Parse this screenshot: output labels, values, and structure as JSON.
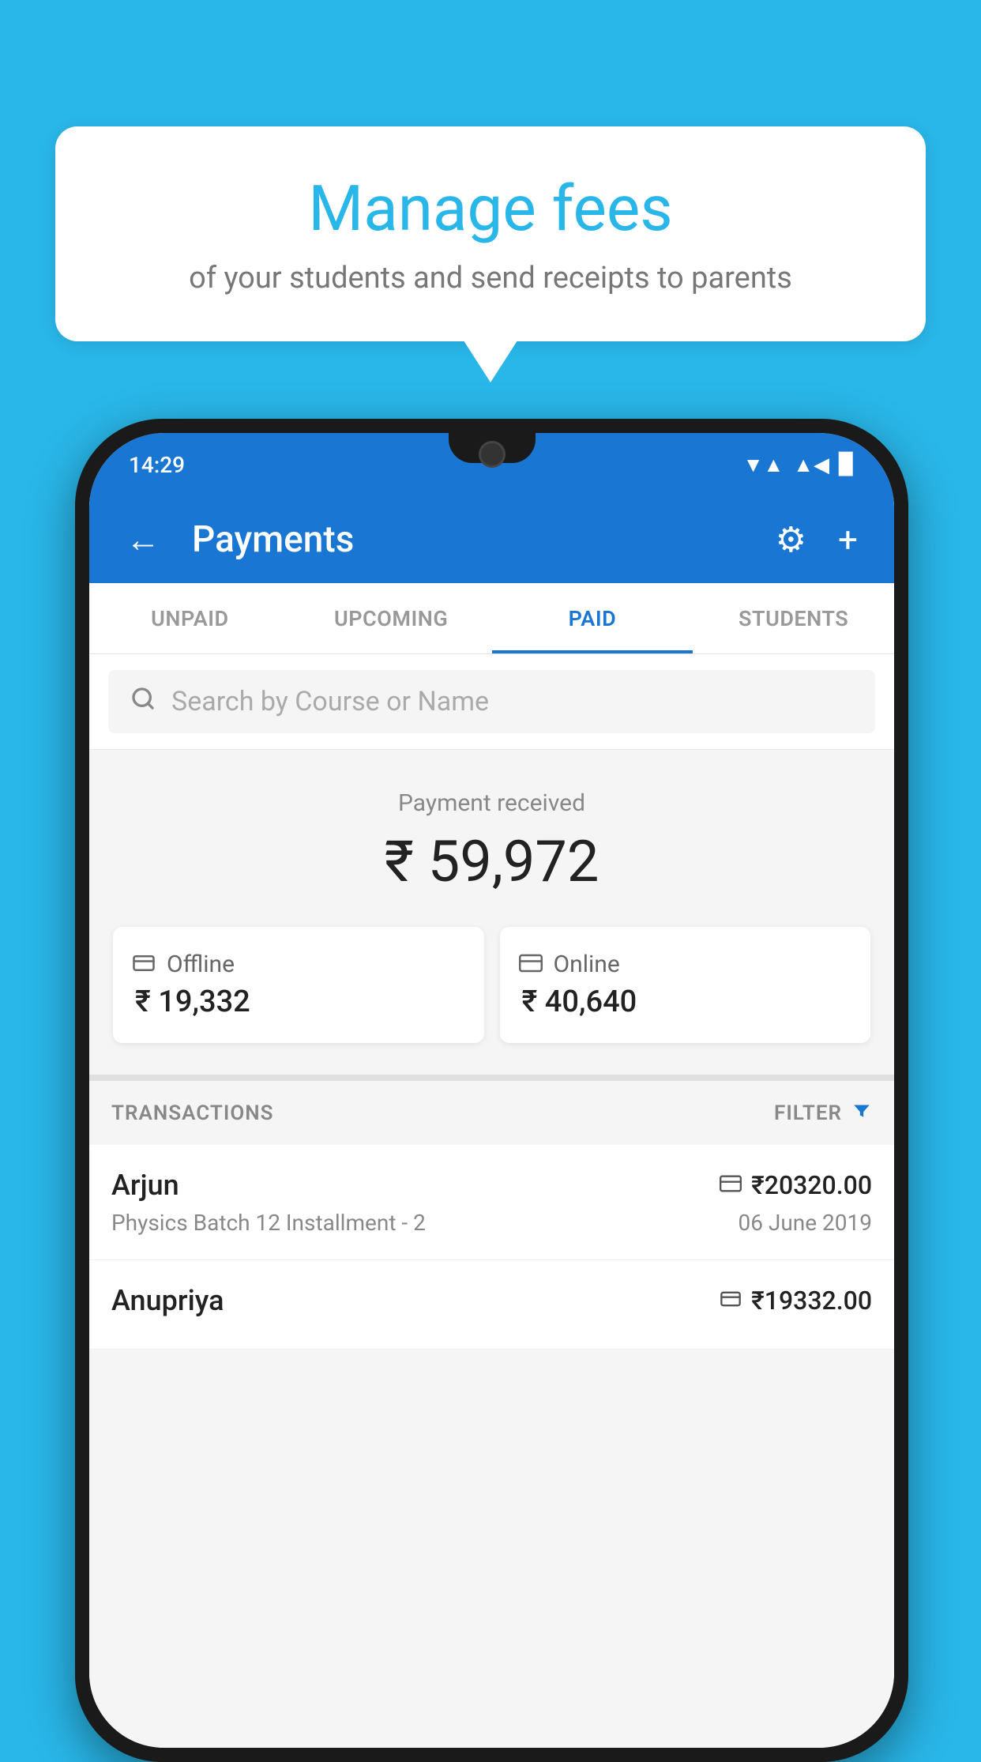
{
  "page": {
    "background_color": "#29B6E8"
  },
  "speech_bubble": {
    "title": "Manage fees",
    "subtitle": "of your students and send receipts to parents"
  },
  "status_bar": {
    "time": "14:29",
    "wifi": "▼▲",
    "signal": "▲",
    "battery": "▉"
  },
  "app_bar": {
    "title": "Payments",
    "back_icon": "←",
    "settings_icon": "⚙",
    "add_icon": "+"
  },
  "tabs": [
    {
      "id": "unpaid",
      "label": "UNPAID",
      "active": false
    },
    {
      "id": "upcoming",
      "label": "UPCOMING",
      "active": false
    },
    {
      "id": "paid",
      "label": "PAID",
      "active": true
    },
    {
      "id": "students",
      "label": "STUDENTS",
      "active": false
    }
  ],
  "search": {
    "placeholder": "Search by Course or Name"
  },
  "payment_summary": {
    "received_label": "Payment received",
    "total_amount": "₹ 59,972",
    "offline": {
      "type": "Offline",
      "amount": "₹ 19,332",
      "icon": "💳"
    },
    "online": {
      "type": "Online",
      "amount": "₹ 40,640",
      "icon": "💳"
    }
  },
  "transactions": {
    "section_label": "TRANSACTIONS",
    "filter_label": "FILTER",
    "items": [
      {
        "name": "Arjun",
        "amount": "₹20320.00",
        "course": "Physics Batch 12 Installment - 2",
        "date": "06 June 2019",
        "payment_type": "online"
      },
      {
        "name": "Anupriya",
        "amount": "₹19332.00",
        "course": "",
        "date": "",
        "payment_type": "offline"
      }
    ]
  }
}
